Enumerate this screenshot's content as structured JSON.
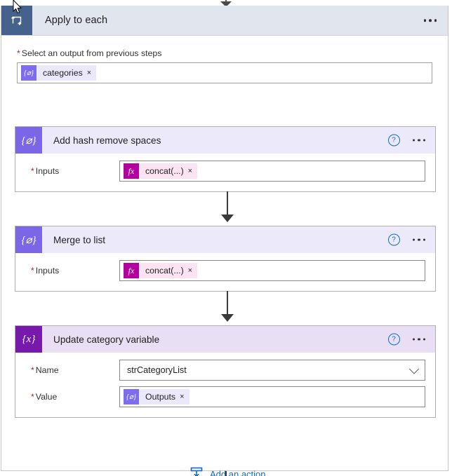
{
  "scope": {
    "title": "Apply to each",
    "icon": "loop-icon",
    "menu": "overflow-menu",
    "foreach_field": {
      "label": "Select an output from previous steps",
      "required": true,
      "token": {
        "text": "categories",
        "icon": "dynamic-content-icon",
        "remove": "×"
      }
    }
  },
  "cards": [
    {
      "title": "Add hash remove spaces",
      "icon_glyph": "{⌀}",
      "icon_kind": "compose-icon",
      "help": "?",
      "menu": "overflow-menu",
      "fields": [
        {
          "label": "Inputs",
          "required": true,
          "kind": "token",
          "token": {
            "text": "concat(...)",
            "icon": "fx-icon",
            "icon_glyph": "fx",
            "remove": "×"
          }
        }
      ]
    },
    {
      "title": "Merge to list",
      "icon_glyph": "{⌀}",
      "icon_kind": "compose-icon",
      "help": "?",
      "menu": "overflow-menu",
      "fields": [
        {
          "label": "Inputs",
          "required": true,
          "kind": "token",
          "token": {
            "text": "concat(...)",
            "icon": "fx-icon",
            "icon_glyph": "fx",
            "remove": "×"
          }
        }
      ]
    },
    {
      "title": "Update category variable",
      "icon_glyph": "{x}",
      "icon_kind": "variable-icon",
      "help": "?",
      "menu": "overflow-menu",
      "fields": [
        {
          "label": "Name",
          "required": true,
          "kind": "dropdown",
          "value": "strCategoryList"
        },
        {
          "label": "Value",
          "required": true,
          "kind": "token",
          "token": {
            "text": "Outputs",
            "icon": "dynamic-content-icon",
            "remove": "×"
          }
        }
      ]
    }
  ],
  "add_action": {
    "label": "Add an action",
    "icon": "add-action-icon"
  },
  "colors": {
    "scope_header_bg": "#e1e5ee",
    "scope_icon_bg": "#44628c",
    "compose_icon_bg": "#7c66e8",
    "compose_header_bg": "#ece9fb",
    "variable_icon_bg": "#7719aa",
    "variable_header_bg": "#e9dff5",
    "fx_chip_bg": "#b4009e",
    "link_blue": "#0f6cbd",
    "required_red": "#a4262c"
  }
}
